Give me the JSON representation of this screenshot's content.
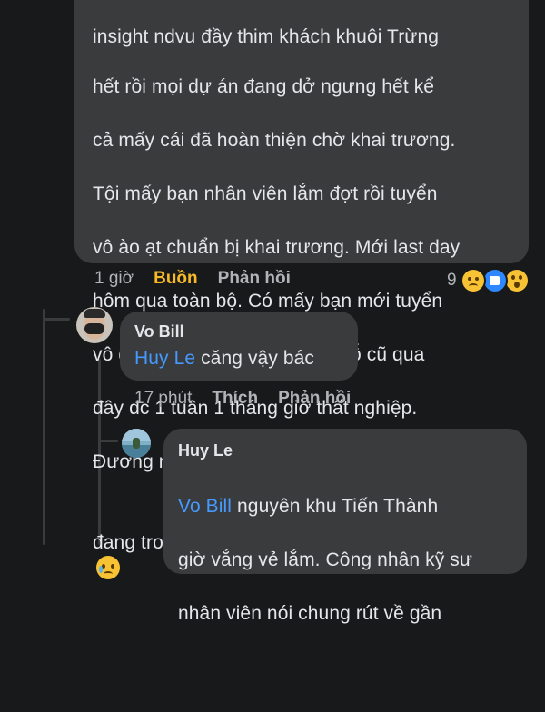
{
  "comment1": {
    "text_lines": [
      "insight ndvu đầy thim khách khuôi Trừng",
      "hết rồi mọi dự án đang dở ngưng hết kể",
      "cả mấy cái đã hoàn thiện chờ khai trương.",
      "Tội mấy bạn nhân viên lắm đợt rồi tuyển",
      "vô ào ạt chuẩn bị khai trương. Mới last day",
      "hôm qua toàn bộ. Có mấy bạn mới tuyển",
      "vô dc 1 tuần. Nộp đơn nghỉ chỗ cũ qua",
      "đây dc 1 tuần 1 tháng giờ thất nghiệp.",
      "Đương nhiên éo dc đền bù hd gì hết vì",
      "đang trong giai đoạn thử việc"
    ],
    "emoji": "sad-but-relieved-emoji",
    "time": "1 giờ",
    "reaction_label": "Buồn",
    "reply_label": "Phản hồi",
    "reaction_count": "9",
    "reaction_icons": [
      "sad-emoji",
      "like-emoji",
      "wow-emoji"
    ]
  },
  "comment2": {
    "author": "Vo Bill",
    "mention": "Huy Le",
    "text": " căng vậy bác",
    "time": "17 phút",
    "like_label": "Thích",
    "reply_label": "Phản hồi"
  },
  "comment3": {
    "author": "Huy Le",
    "mention": "Vo Bill",
    "line1": " nguyên khu Tiến Thành",
    "line2": "giờ vắng vẻ lắm. Công nhân kỹ sư",
    "line3": "nhân viên nói chung rút về gần"
  },
  "colors": {
    "background": "#18191a",
    "bubble": "#3a3b3c",
    "mention": "#4599ff",
    "sad_reaction": "#f7b928"
  }
}
